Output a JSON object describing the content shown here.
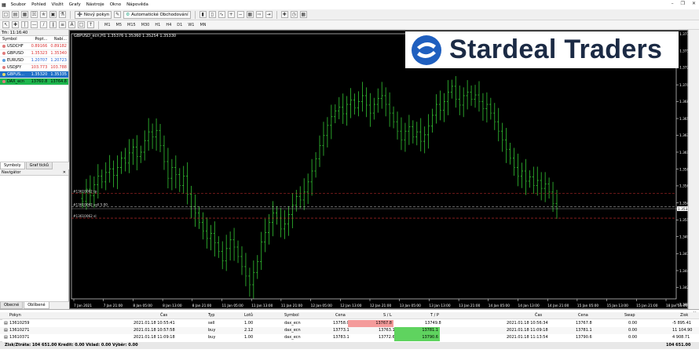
{
  "menu": {
    "items": [
      "Soubor",
      "Pohled",
      "Vložit",
      "Grafy",
      "Nástroje",
      "Okno",
      "Nápověda"
    ]
  },
  "toolbar": {
    "new_order": "Nový pokyn",
    "algo": "Automatické Obchodování",
    "timeframes": [
      "M1",
      "M5",
      "M15",
      "M30",
      "H1",
      "H4",
      "D1",
      "W1",
      "MN"
    ]
  },
  "market_watch": {
    "title": "Trh: 11:16:40",
    "headers": [
      "Symbol",
      "Popt...",
      "Nabí..."
    ],
    "rows": [
      {
        "symbol": "USDCHF",
        "bid": "0.89166",
        "ask": "0.89182",
        "dot": "#e07b7b",
        "state": "dn"
      },
      {
        "symbol": "GBPUSD",
        "bid": "1.35323",
        "ask": "1.35340",
        "dot": "#e07b7b",
        "state": "dn"
      },
      {
        "symbol": "EURUSD",
        "bid": "1.20707",
        "ask": "1.20723",
        "dot": "#5a9ee0",
        "state": "up"
      },
      {
        "symbol": "USDJPY",
        "bid": "103.773",
        "ask": "103.788",
        "dot": "#e07b7b",
        "state": "dn"
      },
      {
        "symbol": "GBPUS...",
        "bid": "1.35320",
        "ask": "1.35335",
        "dot": "#e0d96a",
        "state": "sel"
      },
      {
        "symbol": "DAX_ecn",
        "bid": "13760.8",
        "ask": "13764.8",
        "dot": "#e07b7b",
        "state": "green"
      }
    ],
    "tabs": [
      "Symboly",
      "Graf ticků"
    ]
  },
  "navigator": {
    "title": "Navigátor",
    "tabs": [
      "Obecné",
      "Oblíbené"
    ]
  },
  "chart_header": "GBPUSD_ecn,H1  1.35376 1.35360 1.35254 1.35330",
  "banner": {
    "text": "Stardeal Traders"
  },
  "chart_data": {
    "type": "candlestick",
    "symbol": "GBPUSD_ecn",
    "timeframe": "H1",
    "ohlc_header": [
      1.35376,
      1.3536,
      1.35254,
      1.3533
    ],
    "ylim": [
      1.34085,
      1.37745
    ],
    "yticks": [
      1.37745,
      1.3751,
      1.3728,
      1.3704,
      1.3681,
      1.36575,
      1.36345,
      1.3611,
      1.35875,
      1.35645,
      1.3541,
      1.3533,
      1.35175,
      1.34945,
      1.3471,
      1.34475,
      1.34245,
      1.3401
    ],
    "current_price": "1.35330",
    "xlabels": [
      "7 Jan 2021",
      "7 Jan 21:00",
      "8 Jan 05:00",
      "8 Jan 13:00",
      "8 Jan 21:00",
      "11 Jan 05:00",
      "11 Jan 13:00",
      "11 Jan 21:00",
      "12 Jan 05:00",
      "12 Jan 13:00",
      "12 Jan 21:00",
      "13 Jan 05:00",
      "13 Jan 13:00",
      "13 Jan 21:00",
      "14 Jan 05:00",
      "14 Jan 13:00",
      "14 Jan 21:00",
      "15 Jan 05:00",
      "15 Jan 13:00",
      "15 Jan 21:00",
      "18 Jan 05:00"
    ],
    "closes": [
      1.3543,
      1.356,
      1.3551,
      1.3566,
      1.3578,
      1.357,
      1.3583,
      1.3588,
      1.3579,
      1.359,
      1.3603,
      1.3596,
      1.361,
      1.3618,
      1.3605,
      1.3611,
      1.3627,
      1.3639,
      1.3632,
      1.3641,
      1.362,
      1.3598,
      1.3575,
      1.359,
      1.358,
      1.3565,
      1.3578,
      1.3553,
      1.3536,
      1.3527,
      1.3514,
      1.3502,
      1.3492,
      1.3499,
      1.3486,
      1.3474,
      1.3461,
      1.3478,
      1.349,
      1.348,
      1.3467,
      1.3453,
      1.344,
      1.3428,
      1.3445,
      1.346,
      1.3487,
      1.35,
      1.3514,
      1.3527,
      1.352,
      1.3505,
      1.3512,
      1.3525,
      1.3538,
      1.355,
      1.3545,
      1.3556,
      1.357,
      1.3585,
      1.3602,
      1.362,
      1.3634,
      1.3648,
      1.366,
      1.3668,
      1.3673,
      1.3664,
      1.3677,
      1.3683,
      1.3672,
      1.3681,
      1.3689,
      1.3676,
      1.3665,
      1.3677,
      1.3685,
      1.3689,
      1.3677,
      1.3665,
      1.3653,
      1.364,
      1.3628,
      1.364,
      1.3646,
      1.3632,
      1.3639,
      1.3626,
      1.3635,
      1.3647,
      1.3662,
      1.3677,
      1.3669,
      1.3681,
      1.3694,
      1.3702,
      1.3684,
      1.3676,
      1.3689,
      1.3694,
      1.3684,
      1.369,
      1.3681,
      1.3671,
      1.3677,
      1.3665,
      1.3653,
      1.364,
      1.3628,
      1.3615,
      1.3603,
      1.359,
      1.3578,
      1.3585,
      1.3571,
      1.3577,
      1.3565,
      1.3572,
      1.3561,
      1.3567,
      1.3556,
      1.354,
      1.3533
    ],
    "lines": [
      {
        "label": "#13610062 tp",
        "price": 1.3554,
        "color": "#d03030"
      },
      {
        "label": "#13610062 sell 5.00",
        "price": 1.3536,
        "color": "#c8c8c8"
      },
      {
        "label": "#13610062 sl",
        "price": 1.352,
        "color": "#d03030"
      }
    ]
  },
  "terminal": {
    "headers": [
      "Pokyn",
      "Čas",
      "Typ",
      "Lotů",
      "Symbol",
      "Cena",
      "S / L",
      "T / P",
      "Čas",
      "Cena",
      "Swap",
      "Zisk"
    ],
    "rows": [
      {
        "ticket": "13610259",
        "time": "2021.01.18 10:55:41",
        "type": "sell",
        "lots": "1.00",
        "symbol": "dax_ecn",
        "price": "13758.0",
        "sl": "13767.8",
        "tp": "13749.8",
        "ctime": "2021.01.18 10:56:34",
        "cprice": "13767.8",
        "swap": "0.00",
        "profit": "-5 895.41",
        "sl_hit": true,
        "tp_hit": false
      },
      {
        "ticket": "13610271",
        "time": "2021.01.18 10:57:58",
        "type": "buy",
        "lots": "2.12",
        "symbol": "dax_ecn",
        "price": "13773.1",
        "sl": "13763.1",
        "tp": "13781.1",
        "ctime": "2021.01.18 11:09:18",
        "cprice": "13781.1",
        "swap": "0.00",
        "profit": "11 104.90",
        "sl_hit": false,
        "tp_hit": true
      },
      {
        "ticket": "13610371",
        "time": "2021.01.18 11:09:18",
        "type": "buy",
        "lots": "1.00",
        "symbol": "dax_ecn",
        "price": "13783.1",
        "sl": "13772.6",
        "tp": "13790.6",
        "ctime": "2021.01.18 11:13:54",
        "cprice": "13790.6",
        "swap": "0.00",
        "profit": "4 908.71",
        "sl_hit": false,
        "tp_hit": true
      }
    ],
    "footer": "Zisk/Ztráta: 104 651.00  Kredit: 0.00  Vklad: 0.00  Výběr: 0.00",
    "total": "104 651.00"
  },
  "colors": {
    "candle_up": "#33c433",
    "candle_down": "#2a8a2a",
    "chart_bg": "#000000",
    "axis": "#ffffff",
    "sl_cell": "#f49b9b",
    "tp_cell": "#5fd35f",
    "banner_logo": "#1f5fbf",
    "banner_text": "#1b2a44"
  }
}
